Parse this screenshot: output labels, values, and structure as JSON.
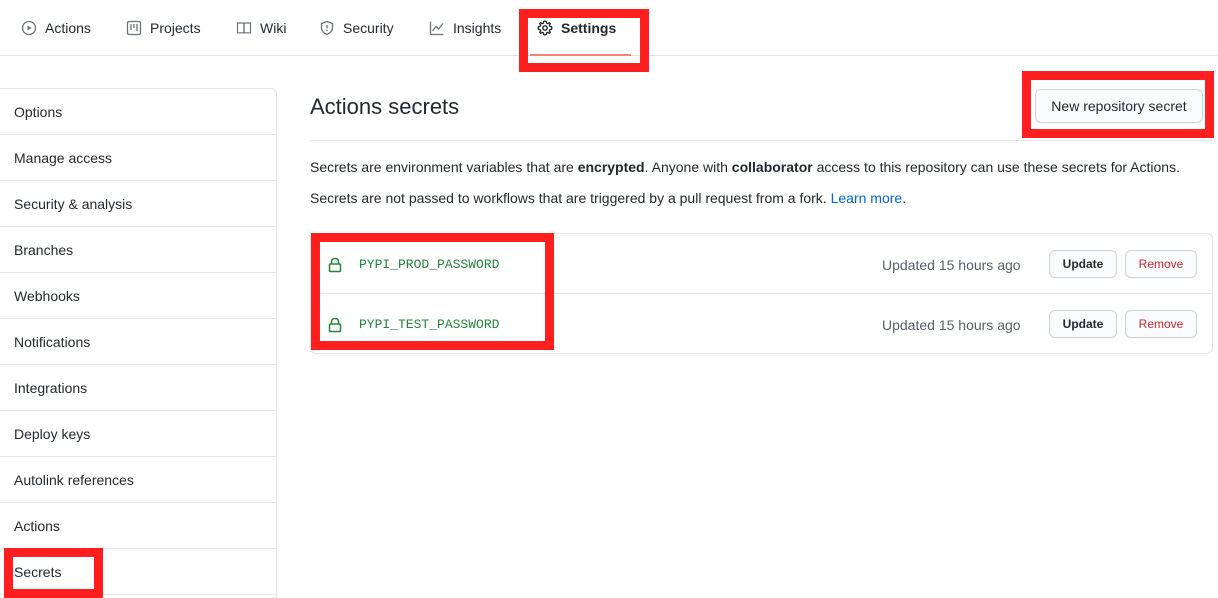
{
  "tabs": [
    {
      "label": "Actions",
      "icon": "play-icon"
    },
    {
      "label": "Projects",
      "icon": "project-icon"
    },
    {
      "label": "Wiki",
      "icon": "book-icon"
    },
    {
      "label": "Security",
      "icon": "shield-icon"
    },
    {
      "label": "Insights",
      "icon": "graph-icon"
    },
    {
      "label": "Settings",
      "icon": "gear-icon",
      "selected": true
    }
  ],
  "sidebar": {
    "items": [
      {
        "label": "Options"
      },
      {
        "label": "Manage access"
      },
      {
        "label": "Security & analysis"
      },
      {
        "label": "Branches"
      },
      {
        "label": "Webhooks"
      },
      {
        "label": "Notifications"
      },
      {
        "label": "Integrations"
      },
      {
        "label": "Deploy keys"
      },
      {
        "label": "Autolink references"
      },
      {
        "label": "Actions"
      },
      {
        "label": "Secrets",
        "selected": true
      }
    ]
  },
  "main": {
    "title": "Actions secrets",
    "new_secret_button": "New repository secret",
    "desc1": {
      "pre": "Secrets are environment variables that are ",
      "bold1": "encrypted",
      "mid": ". Anyone with ",
      "bold2": "collaborator",
      "post": " access to this repository can use these secrets for Actions."
    },
    "desc2": {
      "pre": "Secrets are not passed to workflows that are triggered by a pull request from a fork. ",
      "link": "Learn more",
      "post": "."
    },
    "secrets": [
      {
        "name": "PYPI_PROD_PASSWORD",
        "updated": "Updated 15 hours ago",
        "update_label": "Update",
        "remove_label": "Remove"
      },
      {
        "name": "PYPI_TEST_PASSWORD",
        "updated": "Updated 15 hours ago",
        "update_label": "Update",
        "remove_label": "Remove"
      }
    ]
  },
  "colors": {
    "annotation": "#ff1f1f",
    "secret_name": "#22863a",
    "remove": "#cb2431",
    "link": "#0366d6",
    "tab_underline": "#f9826c"
  }
}
